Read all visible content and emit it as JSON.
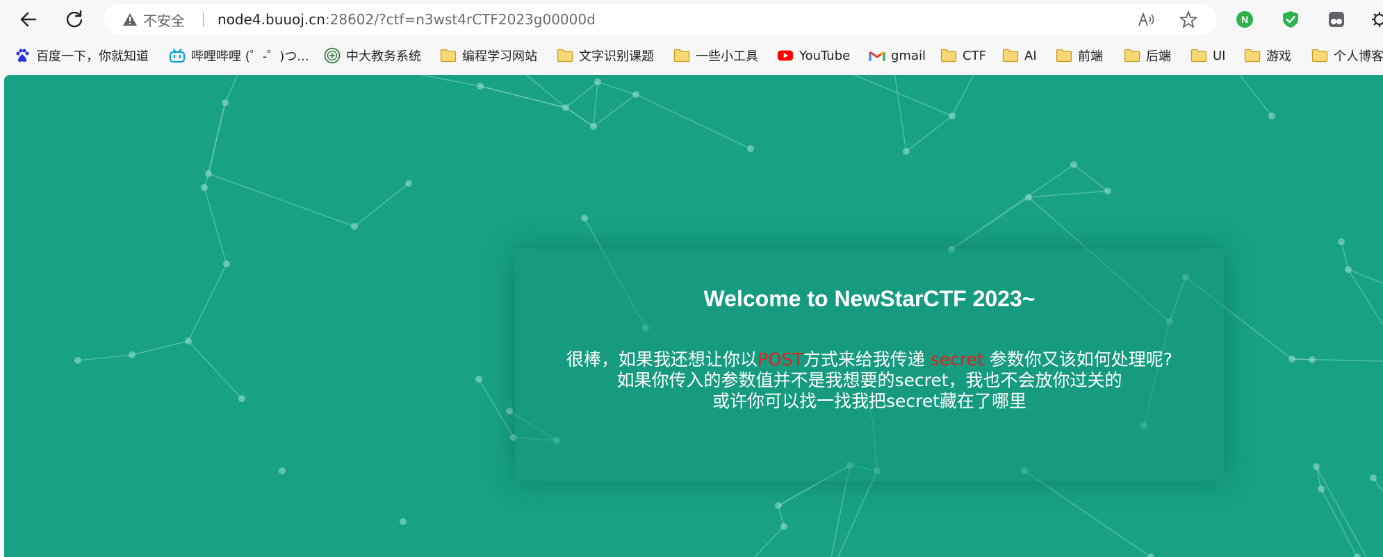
{
  "browser": {
    "security_label": "不安全",
    "url_host": "node4.buuoj.cn",
    "url_rest": ":28602/?ctf=n3wst4rCTF2023g00000d",
    "extensions": [
      {
        "name": "N",
        "color": "#2db24c"
      },
      {
        "name": "shield",
        "color": "#2db24c"
      },
      {
        "name": "tampermonkey",
        "color": "#5f6368"
      }
    ]
  },
  "bookmarks": [
    {
      "label": "百度一下，你就知道",
      "icon": "baidu-icon"
    },
    {
      "label": "哔哩哔哩 (゜-゜)つ...",
      "icon": "bilibili-icon"
    },
    {
      "label": "中大教务系统",
      "icon": "sysu-icon"
    },
    {
      "label": "编程学习网站",
      "icon": "folder-icon"
    },
    {
      "label": "文字识别课题",
      "icon": "folder-icon"
    },
    {
      "label": "一些小工具",
      "icon": "folder-icon"
    },
    {
      "label": "YouTube",
      "icon": "youtube-icon"
    },
    {
      "label": "gmail",
      "icon": "gmail-icon"
    },
    {
      "label": "CTF",
      "icon": "folder-icon"
    },
    {
      "label": "AI",
      "icon": "folder-icon"
    },
    {
      "label": "前端",
      "icon": "folder-icon"
    },
    {
      "label": "后端",
      "icon": "folder-icon"
    },
    {
      "label": "UI",
      "icon": "folder-icon"
    },
    {
      "label": "游戏",
      "icon": "folder-icon"
    },
    {
      "label": "个人博客",
      "icon": "folder-icon"
    }
  ],
  "page": {
    "background_color": "#18a184",
    "title": "Welcome to NewStarCTF 2023~",
    "line1_a": "很棒，如果我还想让你以",
    "line1_post": "POST",
    "line1_b": "方式来给我传递 ",
    "line1_secret": "secret",
    "line1_c": " 参数你又该如何处理呢?",
    "line2": "如果你传入的参数值并不是我想要的secret，我也不会放你过关的",
    "line3": "或许你可以找一找我把secret藏在了哪里"
  }
}
